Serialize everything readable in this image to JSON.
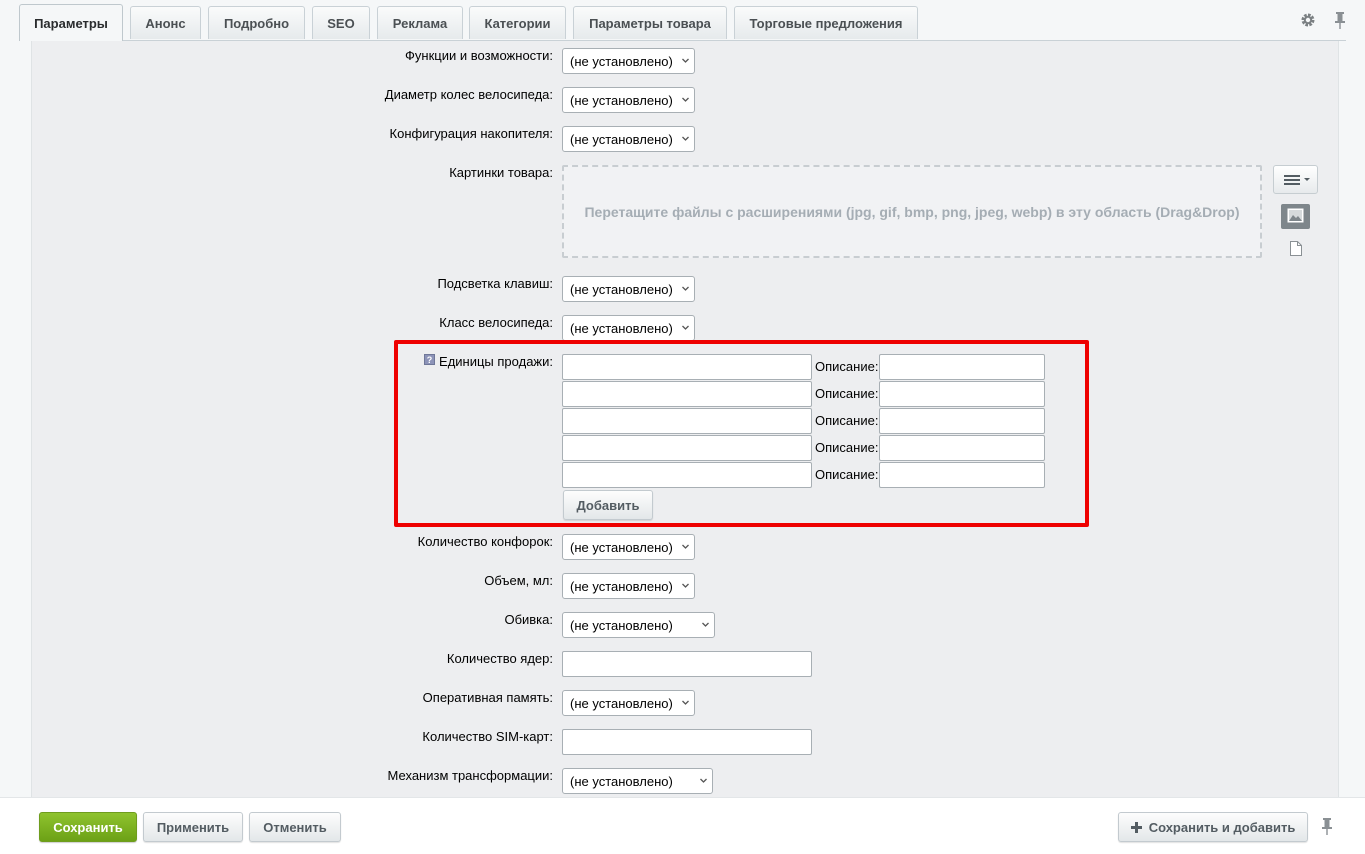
{
  "tabs": [
    "Параметры",
    "Анонс",
    "Подробно",
    "SEO",
    "Реклама",
    "Категории",
    "Параметры товара",
    "Торговые предложения"
  ],
  "icons": {
    "settings": "gear-icon",
    "pin": "pin-icon",
    "image": "image-icon",
    "file": "file-icon",
    "menu": "menu-icon",
    "help": "help-icon",
    "plus": "plus-icon"
  },
  "not_set": "(не установлено)",
  "fields": {
    "functions": "Функции и возможности:",
    "wheel_diameter": "Диаметр колес велосипеда:",
    "storage_config": "Конфигурация накопителя:",
    "product_images": "Картинки товара:",
    "key_backlight": "Подсветка клавиш:",
    "bike_class": "Класс велосипеда:",
    "sale_units": "Единицы продажи:",
    "burners": "Количество конфорок:",
    "volume": "Объем, мл:",
    "upholstery": "Обивка:",
    "cores": "Количество ядер:",
    "ram": "Оперативная память:",
    "sim_count": "Количество SIM-карт:",
    "transform_mechanism": "Механизм трансформации:"
  },
  "dropzone_text": "Перетащите файлы с расширениями (jpg, gif, bmp, png, jpeg, webp) в эту область (Drag&Drop)",
  "description_label": "Описание:",
  "add_button": "Добавить",
  "footer": {
    "save": "Сохранить",
    "apply": "Применить",
    "cancel": "Отменить",
    "save_add": "Сохранить и добавить"
  },
  "colors": {
    "accent_green": "#7cb225",
    "highlight_red": "#ee0000"
  }
}
